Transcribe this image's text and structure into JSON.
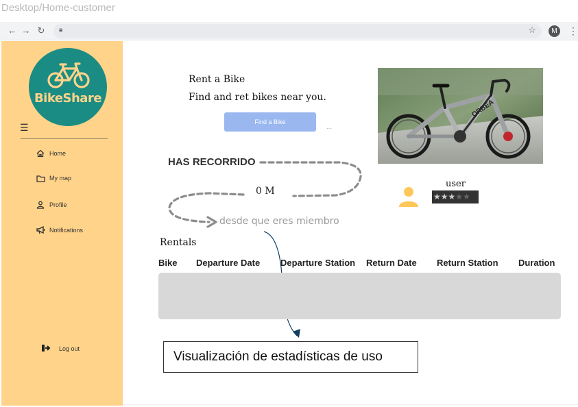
{
  "frame_title": "Desktop/Home-customer",
  "browser": {
    "back_icon": "arrow-left-icon",
    "forward_icon": "arrow-right-icon",
    "reload_icon": "reload-icon",
    "lock_icon": "lock-icon",
    "star_icon": "star-icon",
    "profile_initial": "M",
    "menu_icon": "kebab-icon"
  },
  "sidebar": {
    "logo_text": "BikeShare",
    "brand_color": "#1a8c83",
    "background": "#ffd38a",
    "items": [
      {
        "label": "Home",
        "icon": "home-icon"
      },
      {
        "label": "My map",
        "icon": "folder-icon"
      },
      {
        "label": "Profile",
        "icon": "person-icon"
      },
      {
        "label": "Notifications",
        "icon": "megaphone-icon"
      }
    ],
    "logout_label": "Log out",
    "logout_icon": "logout-icon"
  },
  "main": {
    "rent_title": "Rent a Bike",
    "rent_subtitle": "Find and ret bikes near you.",
    "find_button": "Find a Bike",
    "more_dots": "...",
    "stats": {
      "heading": "HAS RECORRIDO",
      "distance": "0 M",
      "caption": "desde que eres miembro"
    },
    "user": {
      "name": "user",
      "rating_filled": 3,
      "rating_total": 5
    },
    "rentals": {
      "title": "Rentals",
      "columns": [
        "Bike",
        "Departure Date",
        "Departure Station",
        "Return Date",
        "Return Station",
        "Duration"
      ]
    }
  },
  "annotation": {
    "label": "Visualización de estadísticas de uso"
  }
}
